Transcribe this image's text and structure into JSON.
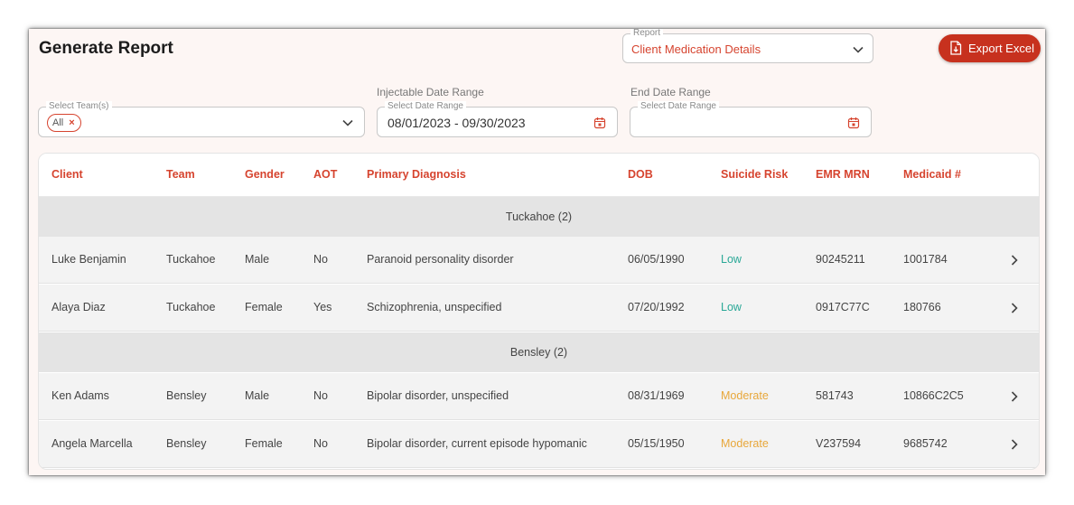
{
  "page": {
    "title": "Generate Report"
  },
  "report": {
    "label": "Report",
    "value": "Client Medication Details"
  },
  "export": {
    "label": "Export Excel"
  },
  "team_filter": {
    "label": "Select Team(s)",
    "chip": "All"
  },
  "injectable_range": {
    "label": "Injectable Date Range",
    "placeholder_label": "Select Date Range",
    "value": "08/01/2023 - 09/30/2023"
  },
  "end_range": {
    "label": "End Date Range",
    "placeholder_label": "Select Date Range",
    "value": ""
  },
  "table": {
    "columns": [
      "Client",
      "Team",
      "Gender",
      "AOT",
      "Primary Diagnosis",
      "DOB",
      "Suicide Risk",
      "EMR MRN",
      "Medicaid #"
    ],
    "groups": [
      {
        "label": "Tuckahoe (2)",
        "rows": [
          {
            "client": "Luke Benjamin",
            "team": "Tuckahoe",
            "gender": "Male",
            "aot": "No",
            "diagnosis": "Paranoid personality disorder",
            "dob": "06/05/1990",
            "risk": "Low",
            "emr": "90245211",
            "medicaid": "1001784"
          },
          {
            "client": "Alaya Diaz",
            "team": "Tuckahoe",
            "gender": "Female",
            "aot": "Yes",
            "diagnosis": "Schizophrenia, unspecified",
            "dob": "07/20/1992",
            "risk": "Low",
            "emr": "0917C77C",
            "medicaid": "180766"
          }
        ]
      },
      {
        "label": "Bensley (2)",
        "rows": [
          {
            "client": "Ken Adams",
            "team": "Bensley",
            "gender": "Male",
            "aot": "No",
            "diagnosis": "Bipolar disorder, unspecified",
            "dob": "08/31/1969",
            "risk": "Moderate",
            "emr": "581743",
            "medicaid": "10866C2C5"
          },
          {
            "client": "Angela Marcella",
            "team": "Bensley",
            "gender": "Female",
            "aot": "No",
            "diagnosis": "Bipolar disorder, current episode hypomanic",
            "dob": "05/15/1950",
            "risk": "Moderate",
            "emr": "V237594",
            "medicaid": "9685742"
          }
        ]
      }
    ]
  },
  "colors": {
    "accent": "#d6442f",
    "button": "#c7311e",
    "risk_low": "#2aa897",
    "risk_moderate": "#e8a73a",
    "background": "#fdf6f4"
  }
}
